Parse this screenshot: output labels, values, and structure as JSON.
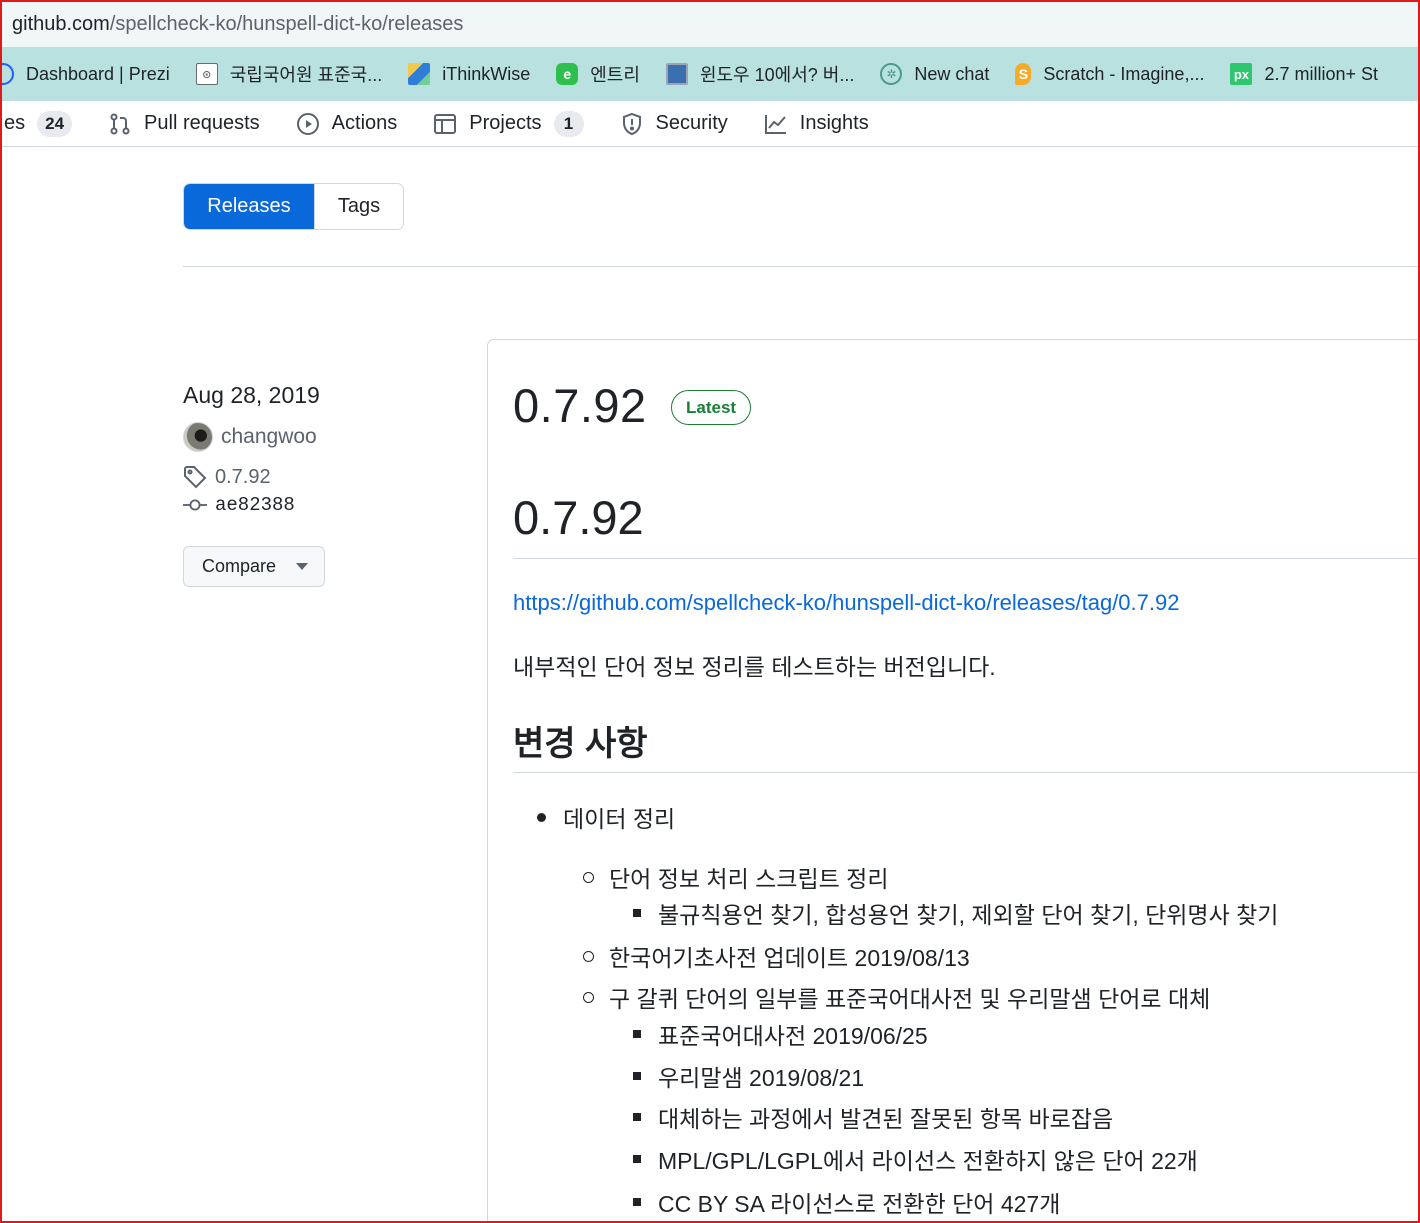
{
  "browser": {
    "address_host": "github.com",
    "address_path": "/spellcheck-ko/hunspell-dict-ko/releases",
    "bookmarks": [
      {
        "label": "Dashboard | Prezi",
        "icon": "prezi-icon",
        "color": "#1f5fff"
      },
      {
        "label": "국립국어원 표준국...",
        "icon": "korean-institute-icon",
        "color": "#6b6b6b"
      },
      {
        "label": "iThinkWise",
        "icon": "ithinkwise-icon",
        "color": "#2e7dd7"
      },
      {
        "label": "엔트리",
        "icon": "entry-icon",
        "color": "#2fbf4f"
      },
      {
        "label": "윈도우 10에서? 버...",
        "icon": "windows-icon",
        "color": "#3a6fb0"
      },
      {
        "label": "New chat",
        "icon": "chatgpt-icon",
        "color": "#4a9a8a"
      },
      {
        "label": "Scratch - Imagine,...",
        "icon": "scratch-icon",
        "color": "#f7a928"
      },
      {
        "label": "2.7 million+ St",
        "icon": "pixabay-icon",
        "color": "#2ec66e"
      }
    ]
  },
  "repo_nav": {
    "issues_label": "es",
    "issues_count": "24",
    "pulls_label": "Pull requests",
    "actions_label": "Actions",
    "projects_label": "Projects",
    "projects_count": "1",
    "security_label": "Security",
    "insights_label": "Insights"
  },
  "tabs": {
    "releases": "Releases",
    "tags": "Tags"
  },
  "meta": {
    "date": "Aug 28, 2019",
    "author": "changwoo",
    "tag": "0.7.92",
    "commit": "ae82388",
    "compare_label": "Compare"
  },
  "release": {
    "title": "0.7.92",
    "badge": "Latest",
    "heading": "0.7.92",
    "link": "https://github.com/spellcheck-ko/hunspell-dict-ko/releases/tag/0.7.92",
    "description": "내부적인 단어 정보 정리를 테스트하는 버전입니다.",
    "changes_heading": "변경 사항",
    "list": {
      "l1": "데이터 정리",
      "l2a": "단어 정보 처리 스크립트 정리",
      "l3a": "불규칙용언 찾기, 합성용언 찾기, 제외할 단어 찾기, 단위명사 찾기",
      "l2b": "한국어기초사전 업데이트 2019/08/13",
      "l2c": "구 갈퀴 단어의 일부를 표준국어대사전 및 우리말샘 단어로 대체",
      "l3b": "표준국어대사전 2019/06/25",
      "l3c": "우리말샘 2019/08/21",
      "l3d": "대체하는 과정에서 발견된 잘못된 항목 바로잡음",
      "l3e": "MPL/GPL/LGPL에서 라이선스 전환하지 않은 단어 22개",
      "l3f": "CC BY SA 라이선스로 전환한 단어 427개"
    }
  },
  "colors": {
    "accent": "#0969da",
    "latest_green": "#1a7f37",
    "bookmark_bar": "#b9e1e0",
    "frame_red": "#e0191b"
  }
}
